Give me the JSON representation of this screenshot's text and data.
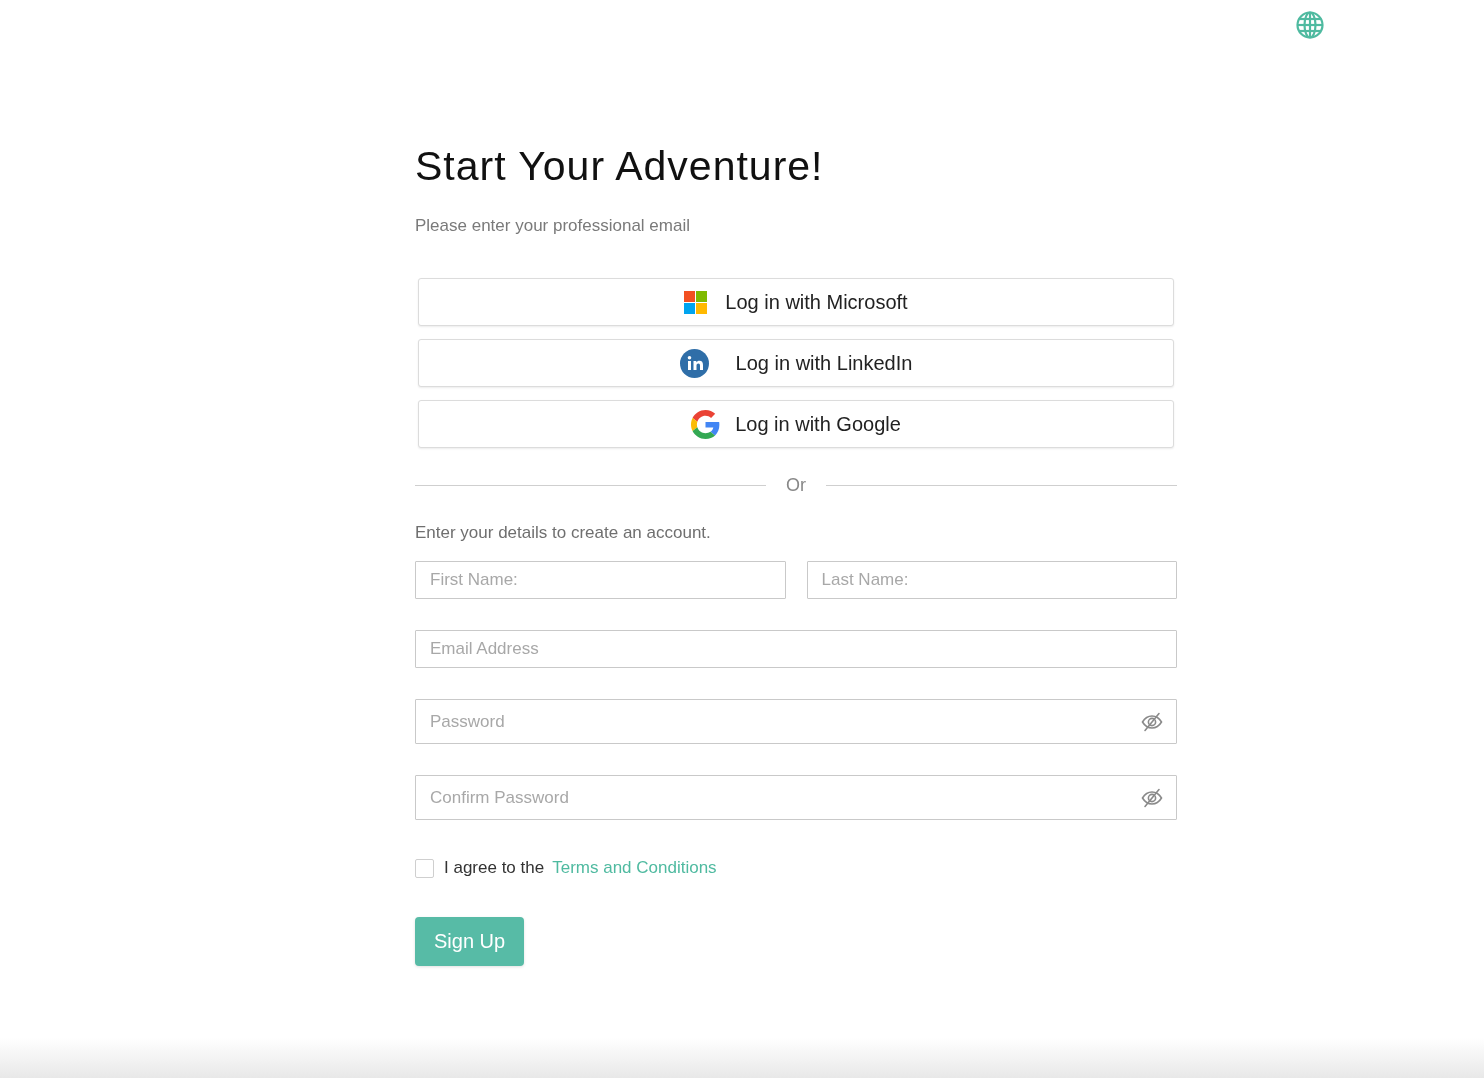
{
  "title": "Start Your Adventure!",
  "subtitle": "Please enter your professional email",
  "social_logins": [
    {
      "kind": "microsoft",
      "label": "Log in with Microsoft"
    },
    {
      "kind": "linkedin",
      "label": "Log in with LinkedIn"
    },
    {
      "kind": "google",
      "label": "Log in with Google"
    }
  ],
  "divider_label": "Or",
  "form_intro": "Enter your details to create an account.",
  "name_fields": [
    {
      "placeholder": "First Name:"
    },
    {
      "placeholder": "Last Name:"
    }
  ],
  "fields": [
    {
      "kind": "email",
      "placeholder": "Email Address"
    },
    {
      "kind": "password",
      "placeholder": "Password"
    },
    {
      "kind": "password",
      "placeholder": "Confirm Password"
    }
  ],
  "terms": {
    "checked": false,
    "text": "I agree to the",
    "link": "Terms and Conditions"
  },
  "submit": "Sign Up"
}
